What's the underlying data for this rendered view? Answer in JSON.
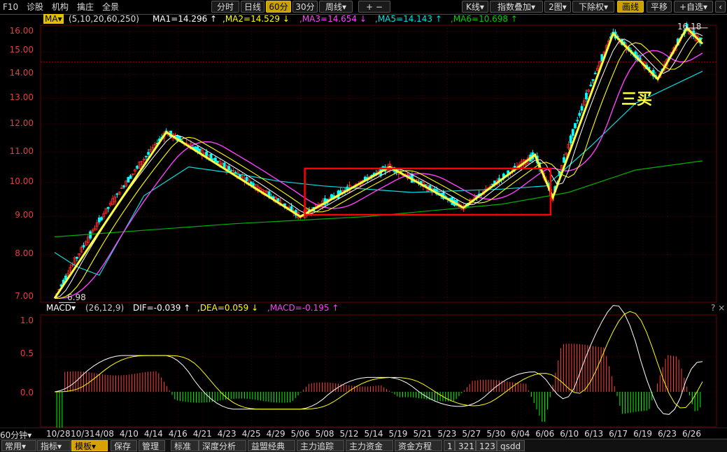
{
  "topbar": {
    "code_label": "F10",
    "menus": [
      "诊股",
      "机构",
      "擒庄",
      "全景"
    ],
    "periods": [
      "分时",
      "日线",
      "60分",
      "30分",
      "周线▾"
    ],
    "active_period": "60分",
    "zoom_label": "+ −",
    "k_type": "K线▾",
    "overlay": "指数叠加▾",
    "layout": "2图▾",
    "adjust": "下除权▾",
    "draw": "画线",
    "translate": "平移",
    "watchlist": "+自选▾"
  },
  "legend": {
    "ma_button": "MA▾",
    "params": "(5,10,20,60,250)",
    "ma1": "MA1=14.296 ↑",
    "ma2": ",MA2=14.529 ↓",
    "ma3": ",MA3=14.654 ↓",
    "ma5": ",MA5=14.143 ↑",
    "ma6": ",MA6=10.698 ↑"
  },
  "macd_legend": {
    "label": "MACD▾",
    "params": "(26,12,9)",
    "dif": "DIF=-0.039 ↑",
    "dea": ",DEA=0.059 ↓",
    "macd": ",MACD=-0.195 ↑",
    "help": "? ×"
  },
  "price_axis": [
    "16.00",
    "15.00",
    "14.00",
    "13.00",
    "12.00",
    "11.00",
    "10.00",
    "9.00",
    "8.00",
    "7.00"
  ],
  "macd_axis": [
    "1.0",
    "0.5",
    "0.0"
  ],
  "annotations": {
    "high_price": "16.18",
    "low_price": "6.98",
    "third_buy": "三买"
  },
  "period_label": "60分钟▾",
  "dates": [
    "10/28",
    "10/31",
    "4/08",
    "4/10",
    "4/14",
    "4/16",
    "4/21",
    "4/23",
    "4/25",
    "4/29",
    "5/06",
    "5/08",
    "5/12",
    "5/14",
    "5/19",
    "5/21",
    "5/23",
    "5/27",
    "5/30",
    "6/04",
    "6/06",
    "6/10",
    "6/13",
    "6/17",
    "6/19",
    "6/23",
    "6/26"
  ],
  "bottom_tabs": [
    "常用▾",
    "指标▾",
    "模板▾",
    "保存",
    "管理",
    "标准",
    "深度分析",
    "益盟经典",
    "主力追踪",
    "主力资金",
    "资金方程",
    "1",
    "321",
    "123",
    "qsdd"
  ],
  "active_tab": "模板▾",
  "colors": {
    "ma1": "#ffffff",
    "ma2": "#ffff00",
    "ma3": "#ff40ff",
    "ma5": "#00e0e0",
    "ma6": "#00b000",
    "zigzag": "#ffff40",
    "box": "#ff0000",
    "up": "#ff3030",
    "down": "#00ffff"
  },
  "chart_data": {
    "type": "candlestick",
    "zigzag_path": [
      [
        0,
        6.98
      ],
      [
        5,
        11.7
      ],
      [
        11,
        9.0
      ],
      [
        15,
        10.5
      ],
      [
        18.3,
        9.25
      ],
      [
        21.5,
        10.9
      ],
      [
        22.3,
        9.55
      ],
      [
        25,
        15.9
      ],
      [
        27,
        13.8
      ],
      [
        28.3,
        16.18
      ],
      [
        29,
        15.4
      ]
    ],
    "box": {
      "x0": 11.2,
      "x1": 22.2,
      "y_low": 9.05,
      "y_high": 10.45
    },
    "ma_slow": [
      [
        0,
        8.45
      ],
      [
        8,
        8.8
      ],
      [
        14,
        9.0
      ],
      [
        20,
        9.35
      ],
      [
        23,
        9.7
      ],
      [
        26,
        10.4
      ],
      [
        29,
        10.7
      ]
    ],
    "ma5": [
      [
        0,
        8.05
      ],
      [
        1,
        7.7
      ],
      [
        2,
        7.5
      ],
      [
        4,
        9.6
      ],
      [
        6,
        10.5
      ],
      [
        8,
        10.3
      ],
      [
        10,
        10.05
      ],
      [
        12,
        9.9
      ],
      [
        16,
        9.7
      ],
      [
        20,
        9.8
      ],
      [
        22,
        9.9
      ],
      [
        24,
        11.2
      ],
      [
        26,
        12.8
      ],
      [
        29,
        14.14
      ]
    ]
  }
}
